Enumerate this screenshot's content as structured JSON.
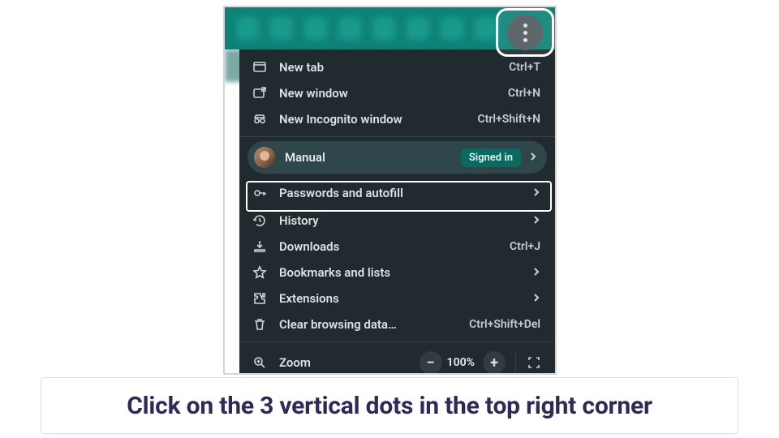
{
  "menu": {
    "items": [
      {
        "label": "New tab",
        "shortcut": "Ctrl+T"
      },
      {
        "label": "New window",
        "shortcut": "Ctrl+N"
      },
      {
        "label": "New Incognito window",
        "shortcut": "Ctrl+Shift+N"
      }
    ],
    "profile": {
      "name": "Manual",
      "badge": "Signed in"
    },
    "items2": [
      {
        "label": "Passwords and autofill"
      },
      {
        "label": "History"
      },
      {
        "label": "Downloads",
        "shortcut": "Ctrl+J"
      },
      {
        "label": "Bookmarks and lists"
      },
      {
        "label": "Extensions"
      },
      {
        "label": "Clear browsing data…",
        "shortcut": "Ctrl+Shift+Del"
      }
    ],
    "zoom": {
      "label": "Zoom",
      "value": "100%"
    }
  },
  "caption": "Click on the 3 vertical dots in the top right corner"
}
